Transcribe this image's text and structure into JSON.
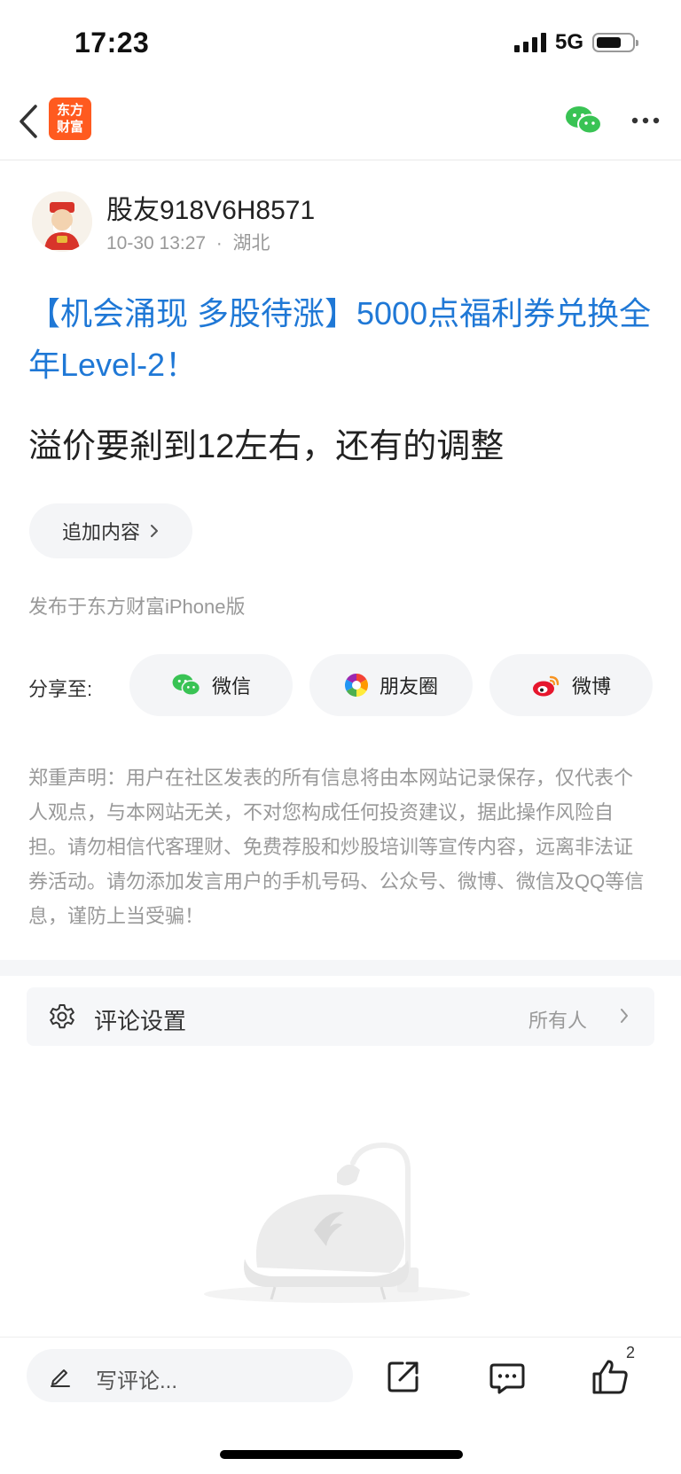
{
  "status_bar": {
    "time": "17:23",
    "network": "5G"
  },
  "nav": {
    "logo_line1": "东方",
    "logo_line2": "财富"
  },
  "author": {
    "name": "股友918V6H8571",
    "time": "10-30 13:27",
    "sep": "·",
    "location": "湖北"
  },
  "post": {
    "title": "【机会涌现 多股待涨】5000点福利券兑换全年Level-2！",
    "body": "溢价要剎到12左右，还有的调整",
    "append_label": "追加内容",
    "published_from": "发布于东方财富iPhone版"
  },
  "share": {
    "label": "分享至:",
    "wechat": "微信",
    "moments": "朋友圈",
    "weibo": "微博"
  },
  "disclaimer": "郑重声明：用户在社区发表的所有信息将由本网站记录保存，仅代表个人观点，与本网站无关，不对您构成任何投资建议，据此操作风险自担。请勿相信代客理财、免费荐股和炒股培训等宣传内容，远离非法证券活动。请勿添加发言用户的手机号码、公众号、微博、微信及QQ等信息，谨防上当受骗！",
  "comment_settings": {
    "label": "评论设置",
    "value": "所有人"
  },
  "bottom_bar": {
    "placeholder": "写评论...",
    "like_count": "2"
  },
  "colors": {
    "link_blue": "#1f78d6",
    "brand_orange": "#ff5a1f",
    "wechat_green": "#39c354",
    "weibo_red": "#e6162d"
  },
  "icons": [
    "back-icon",
    "wechat-icon",
    "more-icon",
    "gear-icon",
    "chevron-right-icon",
    "edit-icon",
    "share-icon",
    "comment-icon",
    "like-icon",
    "moments-icon",
    "weibo-icon"
  ]
}
